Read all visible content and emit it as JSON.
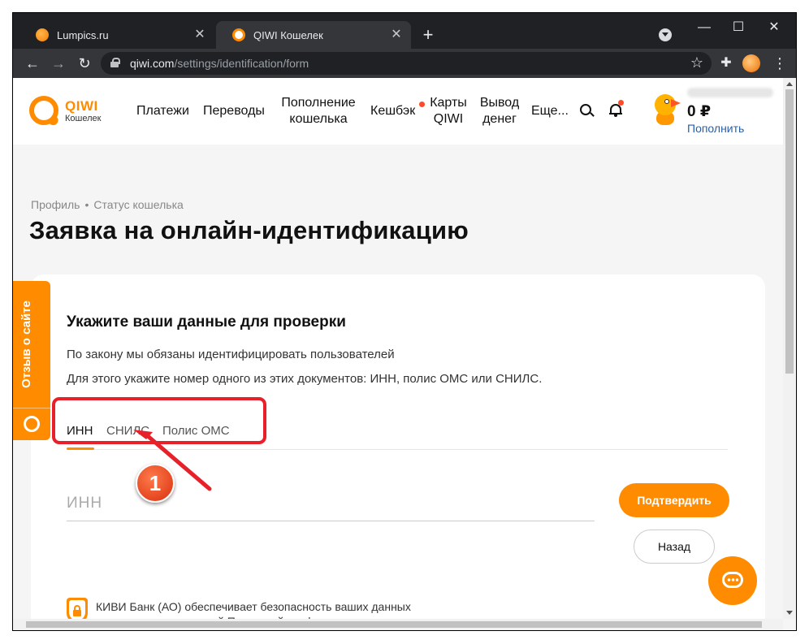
{
  "browser": {
    "tabs": [
      {
        "title": "Lumpics.ru",
        "active": false
      },
      {
        "title": "QIWI Кошелек",
        "active": true
      }
    ],
    "url_host": "qiwi.com",
    "url_path": "/settings/identification/form",
    "window_controls": [
      "minimize",
      "maximize",
      "close"
    ]
  },
  "site": {
    "logo": {
      "brand": "QIWI",
      "subtitle": "Кошелек"
    },
    "nav": [
      {
        "label": "Платежи"
      },
      {
        "label": "Переводы"
      },
      {
        "label": "Пополнение кошелька"
      },
      {
        "label": "Кешбэк"
      },
      {
        "label": "Карты QIWI"
      },
      {
        "label": "Вывод денег"
      },
      {
        "label": "Еще..."
      }
    ],
    "balance": "0 ₽",
    "topup_label": "Пополнить"
  },
  "breadcrumb": [
    "Профиль",
    "Статус кошелька"
  ],
  "page_title": "Заявка на онлайн-идентификацию",
  "feedback_tab": "Отзыв о сайте",
  "form": {
    "heading": "Укажите ваши данные для проверки",
    "line1": "По закону мы обязаны идентифицировать пользователей",
    "line2": "Для этого укажите номер одного из этих документов: ИНН, полис ОМС или СНИЛС.",
    "doc_tabs": [
      {
        "label": "ИНН",
        "active": true
      },
      {
        "label": "СНИЛС",
        "active": false
      },
      {
        "label": "Полис ОМС",
        "active": false
      }
    ],
    "inn_placeholder": "ИНН",
    "inn_value": "",
    "confirm_label": "Подтвердить",
    "back_label": "Назад",
    "security_line1": "КИВИ Банк (АО) обеспечивает безопасность ваших данных",
    "security_line2": "в соответствии со своей Политикой конфиденциальности"
  },
  "annotation": {
    "marker": "1"
  },
  "colors": {
    "accent": "#ff8c00",
    "annotation_red": "#e8202a",
    "link_blue": "#2a5fa8",
    "notification_dot": "#ff4b2b"
  }
}
